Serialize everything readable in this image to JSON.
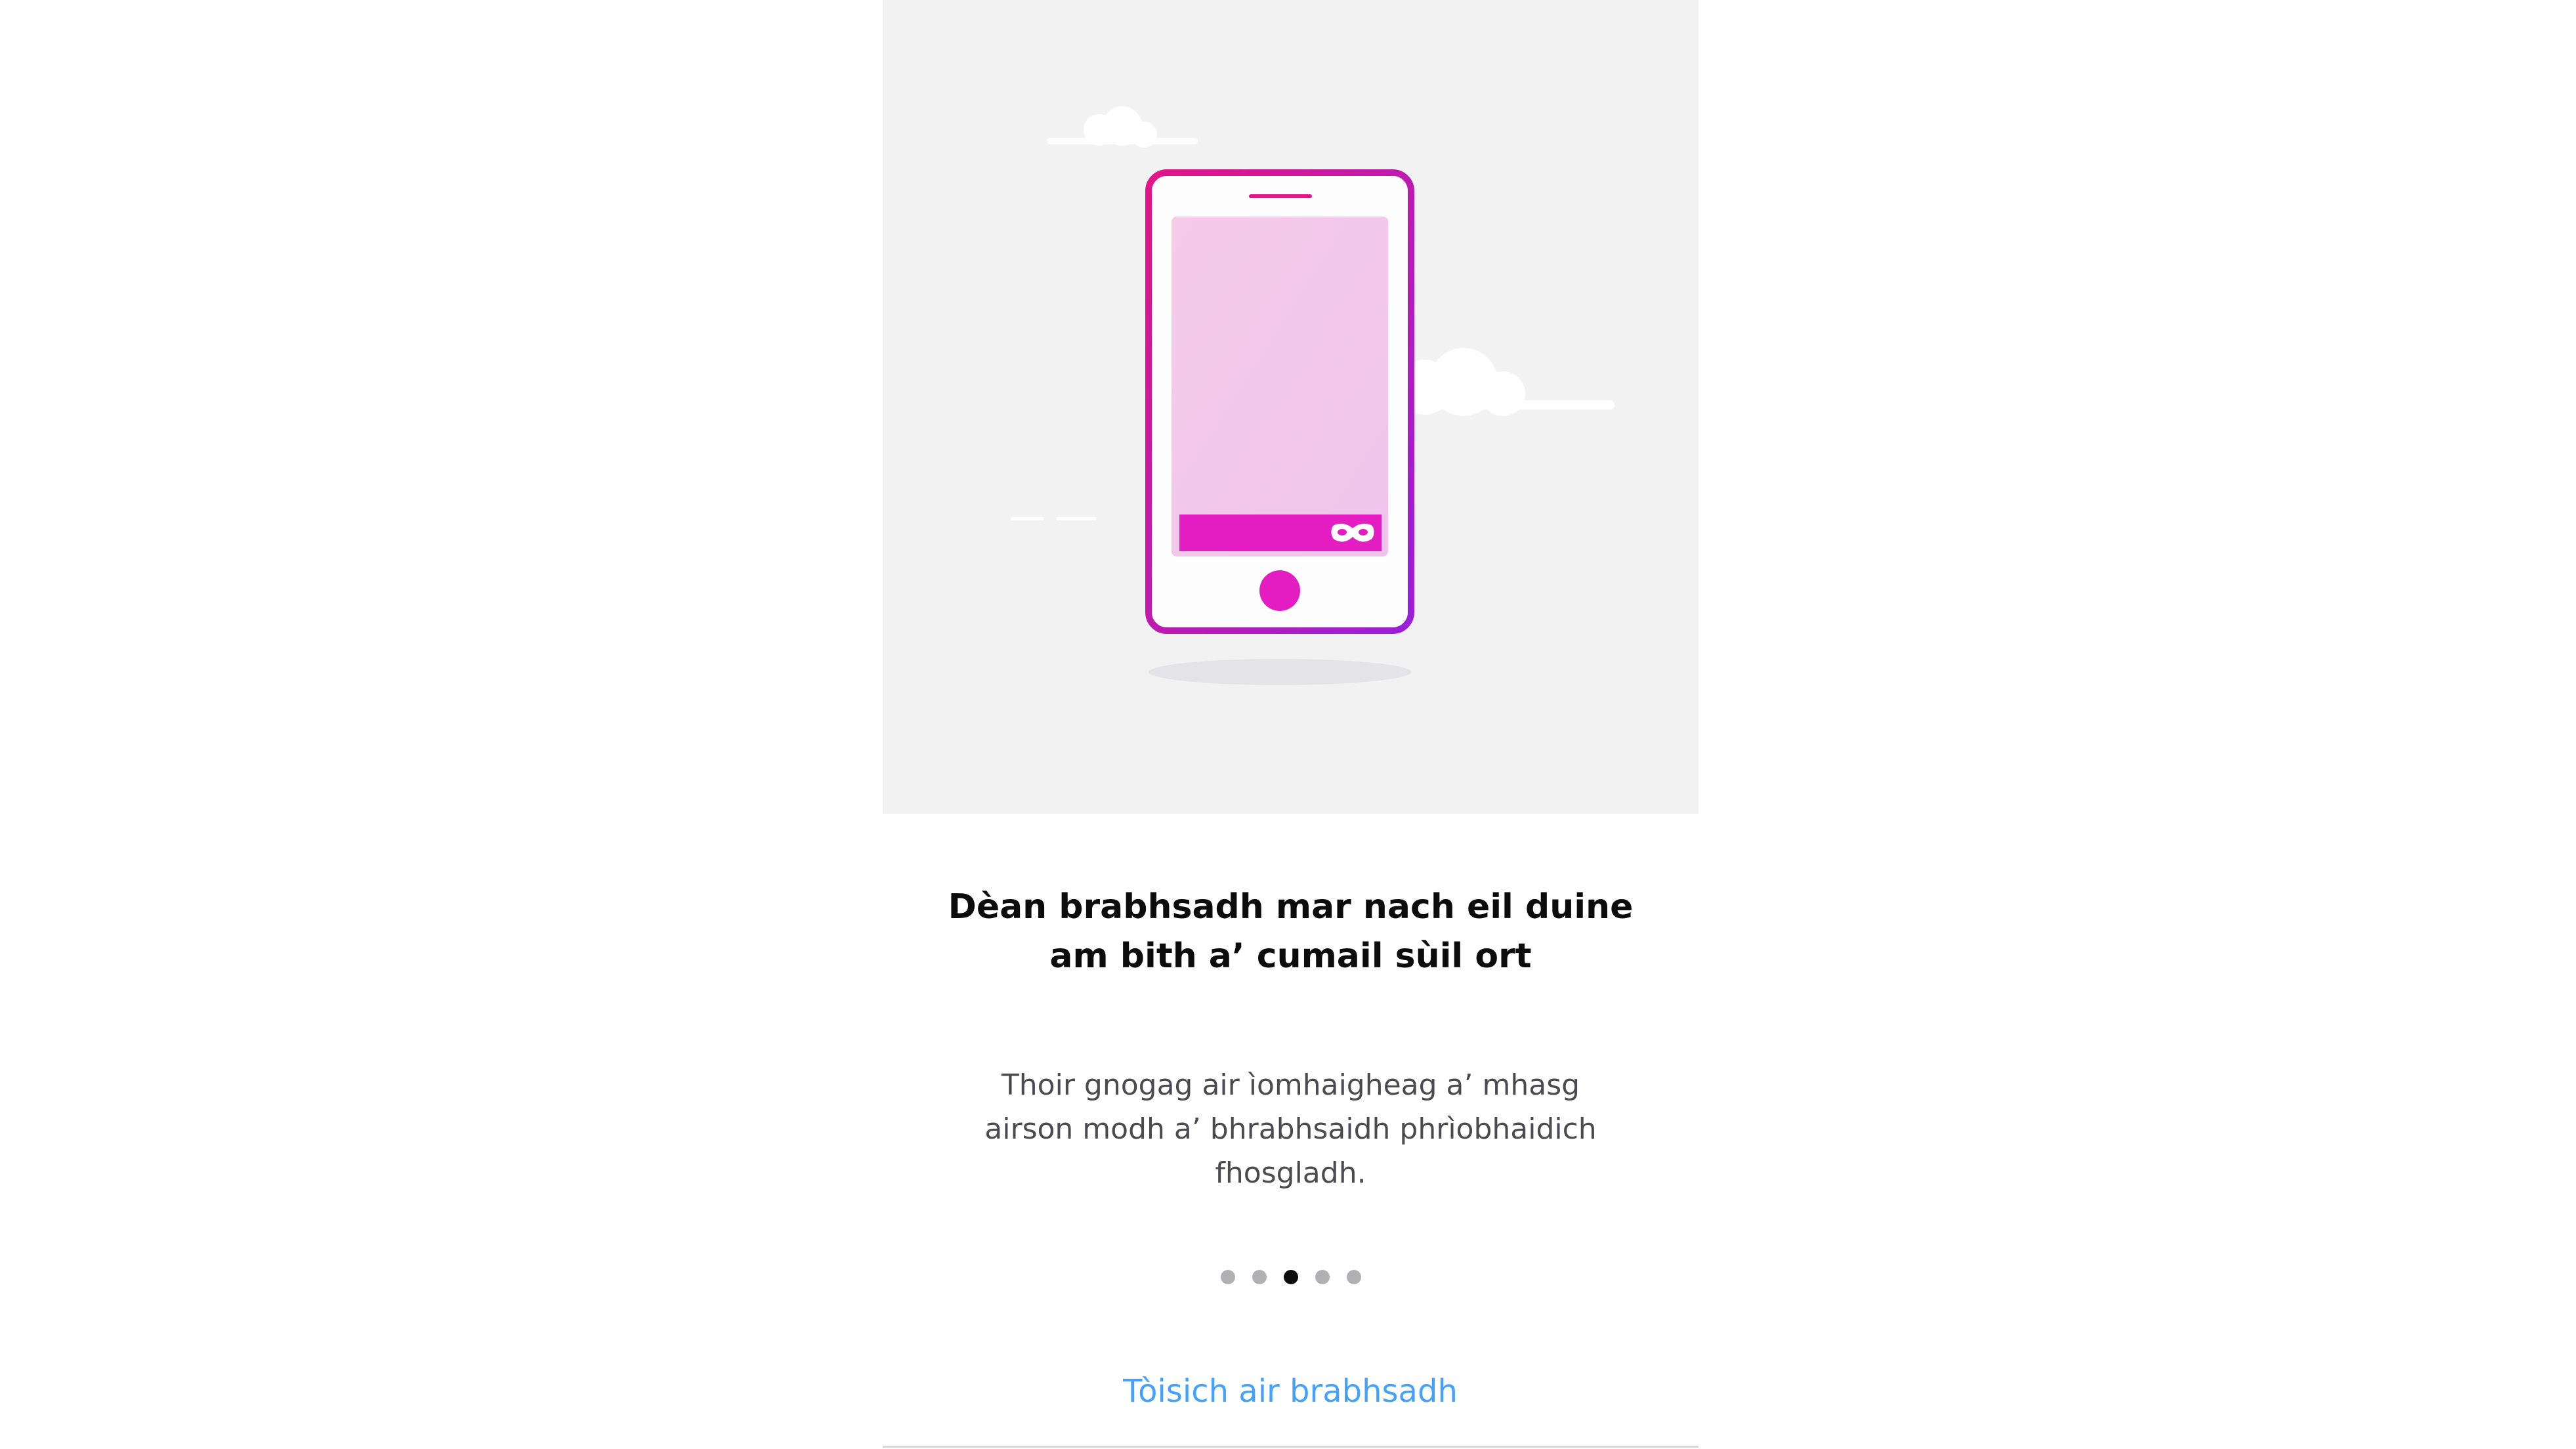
{
  "onboarding": {
    "headline_line1": "Dèan brabhsadh mar nach eil duine",
    "headline_line2": "am bith a’ cumail sùil ort",
    "body_line1": "Thoir gnogag air ìomhaigheag a’ mhasg",
    "body_line2": "airson modh a’ bhrabhsaidh phrìobhaidich",
    "body_line3": "fhosgladh.",
    "pager": {
      "total": 5,
      "active_index": 2
    },
    "start_button_label": "Tòisich air brabhsadh"
  },
  "illustration": {
    "icons": [
      "phone-icon",
      "private-mask-icon",
      "cloud-icon"
    ]
  },
  "colors": {
    "hero_background": "#f2f2f2",
    "phone_outline": "#e31587",
    "phone_outline_end": "#9a1fd9",
    "screen_fill": "#f4c9e9",
    "accent_magenta": "#e31dc1",
    "dot_inactive": "#b1b1b3",
    "dot_active": "#0c0c0d",
    "link_blue": "#45a1ff"
  }
}
